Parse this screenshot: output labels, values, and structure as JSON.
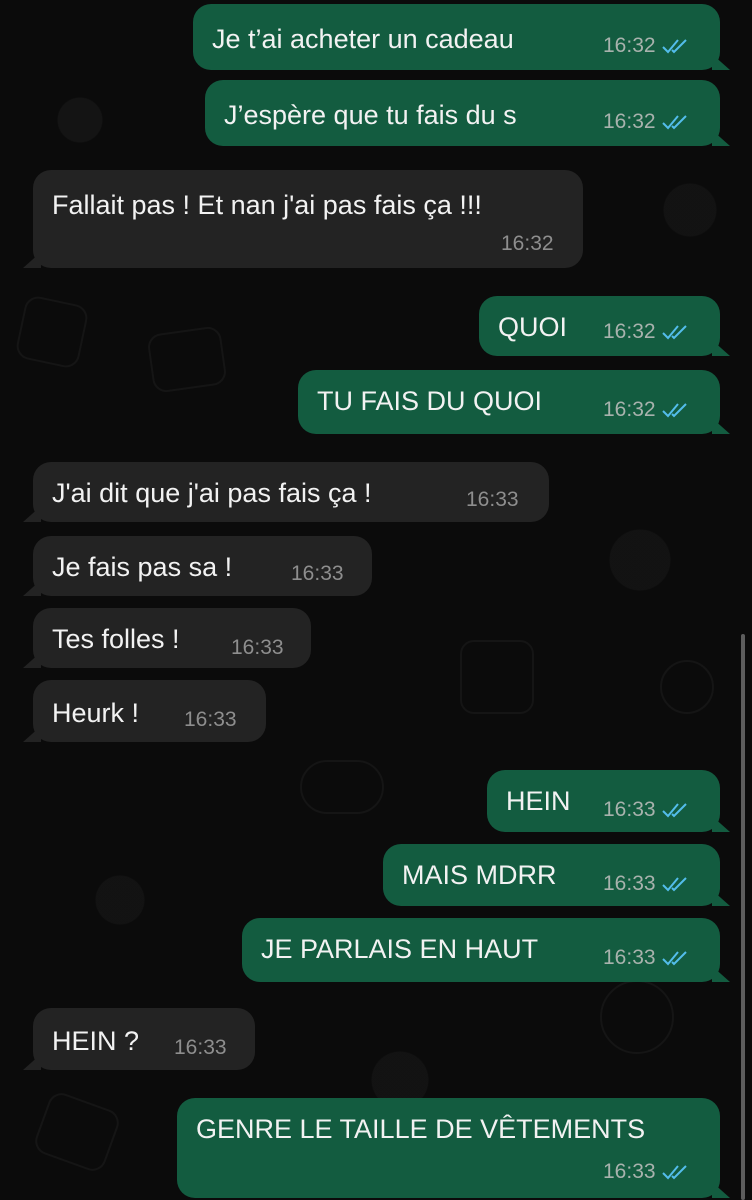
{
  "messages": [
    {
      "dir": "out",
      "text": "Je t’ai acheter un cadeau",
      "time": "16:32"
    },
    {
      "dir": "out",
      "text": "J’espère que tu fais du s",
      "time": "16:32"
    },
    {
      "dir": "in",
      "text": "Fallait pas ! Et nan j'ai pas fais ça !!!",
      "time": "16:32"
    },
    {
      "dir": "out",
      "text": "QUOI",
      "time": "16:32"
    },
    {
      "dir": "out",
      "text": "TU FAIS DU QUOI",
      "time": "16:32"
    },
    {
      "dir": "in",
      "text": "J'ai dit que j'ai pas fais ça !",
      "time": "16:33"
    },
    {
      "dir": "in",
      "text": "Je fais pas sa !",
      "time": "16:33"
    },
    {
      "dir": "in",
      "text": "Tes folles !",
      "time": "16:33"
    },
    {
      "dir": "in",
      "text": "Heurk !",
      "time": "16:33"
    },
    {
      "dir": "out",
      "text": "HEIN",
      "time": "16:33"
    },
    {
      "dir": "out",
      "text": "MAIS MDRR",
      "time": "16:33"
    },
    {
      "dir": "out",
      "text": "JE PARLAIS EN HAUT",
      "time": "16:33"
    },
    {
      "dir": "in",
      "text": "HEIN ?",
      "time": "16:33"
    },
    {
      "dir": "out",
      "text": "GENRE LE TAILLE DE VÊTEMENTS",
      "time": "16:33"
    }
  ],
  "colors": {
    "outgoing_bubble": "#135c40",
    "incoming_bubble": "#232323",
    "read_ticks": "#53bdeb",
    "background": "#0b0b0b"
  },
  "icons": {
    "read_receipt": "double-check-icon"
  }
}
